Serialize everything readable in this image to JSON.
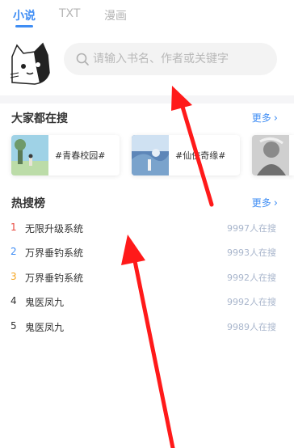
{
  "tabs": [
    {
      "label": "小说",
      "active": true
    },
    {
      "label": "TXT",
      "active": false
    },
    {
      "label": "漫画",
      "active": false
    }
  ],
  "search": {
    "placeholder": "请输入书名、作者或关键字",
    "icon": "search-icon"
  },
  "mascot": {
    "icon": "cat-mascot-icon"
  },
  "trending": {
    "title": "大家都在搜",
    "more": "更多",
    "items": [
      {
        "label": "#青春校园#"
      },
      {
        "label": "#仙侠奇缘#"
      },
      {
        "label": ""
      }
    ]
  },
  "hot": {
    "title": "热搜榜",
    "more": "更多",
    "rows": [
      {
        "rank": "1",
        "title": "无限升级系统",
        "count": "9997人在搜",
        "rank_color": "#e8453c"
      },
      {
        "rank": "2",
        "title": "万界垂钓系统",
        "count": "9993人在搜",
        "rank_color": "#3f8df4"
      },
      {
        "rank": "3",
        "title": "万界垂钓系统",
        "count": "9992人在搜",
        "rank_color": "#f5a623"
      },
      {
        "rank": "4",
        "title": "鬼医凤九",
        "count": "9992人在搜",
        "rank_color": "#333333"
      },
      {
        "rank": "5",
        "title": "鬼医凤九",
        "count": "9989人在搜",
        "rank_color": "#333333"
      }
    ]
  },
  "colors": {
    "accent": "#3f8df4",
    "annotation_arrow": "#ff1a1a"
  }
}
